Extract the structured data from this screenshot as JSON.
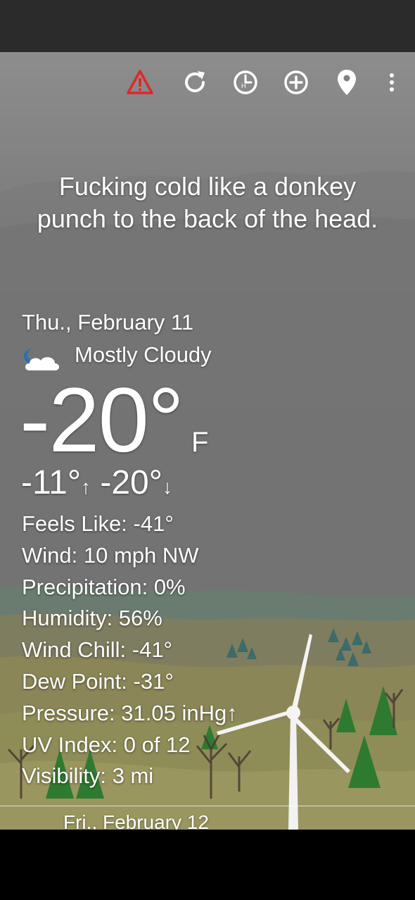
{
  "toolbar": {
    "icons": [
      "warning-icon",
      "refresh-icon",
      "history-icon",
      "add-location-icon",
      "location-pin-icon",
      "overflow-menu-icon"
    ],
    "warning_color": "#e0262a"
  },
  "quote": "Fucking cold like a donkey punch to the back of the head.",
  "today": {
    "date": "Thu., February 11",
    "condition": "Mostly Cloudy",
    "condition_icon": "partly-cloudy-night-icon",
    "temperature": "-20°",
    "unit": "F",
    "high": "-11°",
    "high_arrow": "↑",
    "low": "-20°",
    "low_arrow": "↓"
  },
  "details": [
    "Feels Like: -41°",
    "Wind: 10 mph NW",
    "Precipitation: 0%",
    "Humidity: 56%",
    "Wind Chill: -41°",
    "Dew Point: -31°",
    "Pressure: 31.05 inHg↑",
    "UV Index: 0 of 12",
    "Visibility: 3 mi"
  ],
  "next_day": {
    "date": "Fri., February 12"
  }
}
